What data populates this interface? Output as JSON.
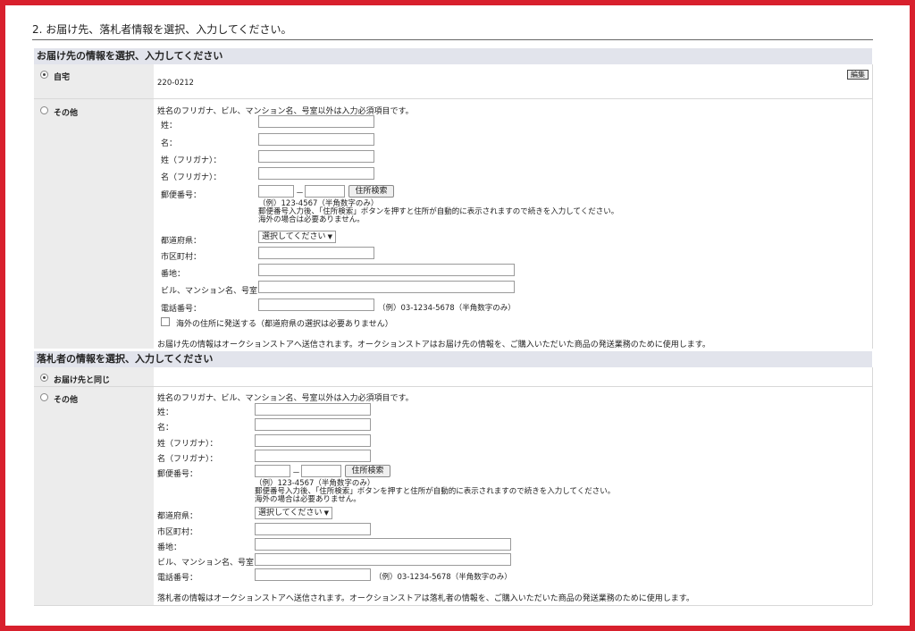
{
  "page_title": "2. お届け先、落札者情報を選択、入力してください。",
  "delivery": {
    "heading": "お届け先の情報を選択、入力してください",
    "home": {
      "label": "自宅",
      "postal": "220-0212",
      "edit_label": "編集",
      "selected": true
    },
    "other": {
      "label": "その他",
      "note": "姓名のフリガナ、ビル、マンション名、号室以外は入力必須項目です。",
      "fields": {
        "last_name": "姓：",
        "first_name": "名：",
        "last_kana": "姓（フリガナ）：",
        "first_kana": "名（フリガナ）：",
        "postal": "郵便番号：",
        "prefecture": "都道府県：",
        "city": "市区町村：",
        "street": "番地：",
        "building": "ビル、マンション名、号室：",
        "phone": "電話番号："
      },
      "postal_dash": "－",
      "postal_search_label": "住所検索",
      "postal_hint_1": "（例）123-4567（半角数字のみ）",
      "postal_hint_2": "郵便番号入力後、「住所検索」ボタンを押すと住所が自動的に表示されますので続きを入力してください。",
      "postal_hint_3": "海外の場合は必要ありません。",
      "prefecture_select": "選択してください",
      "phone_hint": "（例）03-1234-5678（半角数字のみ）",
      "overseas_label": "海外の住所に発送する（都道府県の選択は必要ありません）",
      "footer_note": "お届け先の情報はオークションストアへ送信されます。オークションストアはお届け先の情報を、ご購入いただいた商品の発送業務のために使用します。"
    }
  },
  "bidder": {
    "heading": "落札者の情報を選択、入力してください",
    "same": {
      "label": "お届け先と同じ",
      "selected": true
    },
    "other": {
      "label": "その他",
      "note": "姓名のフリガナ、ビル、マンション名、号室以外は入力必須項目です。",
      "fields": {
        "last_name": "姓：",
        "first_name": "名：",
        "last_kana": "姓（フリガナ）：",
        "first_kana": "名（フリガナ）：",
        "postal": "郵便番号：",
        "prefecture": "都道府県：",
        "city": "市区町村：",
        "street": "番地：",
        "building": "ビル、マンション名、号室：",
        "phone": "電話番号："
      },
      "postal_dash": "－",
      "postal_search_label": "住所検索",
      "postal_hint_1": "（例）123-4567（半角数字のみ）",
      "postal_hint_2": "郵便番号入力後、「住所検索」ボタンを押すと住所が自動的に表示されますので続きを入力してください。",
      "postal_hint_3": "海外の場合は必要ありません。",
      "prefecture_select": "選択してください",
      "phone_hint": "（例）03-1234-5678（半角数字のみ）",
      "footer_note": "落札者の情報はオークションストアへ送信されます。オークションストアは落札者の情報を、ご購入いただいた商品の発送業務のために使用します。"
    }
  },
  "colors": {
    "frame": "#d8202d",
    "section_band": "#e2e4ec",
    "left_column": "#ececec"
  }
}
